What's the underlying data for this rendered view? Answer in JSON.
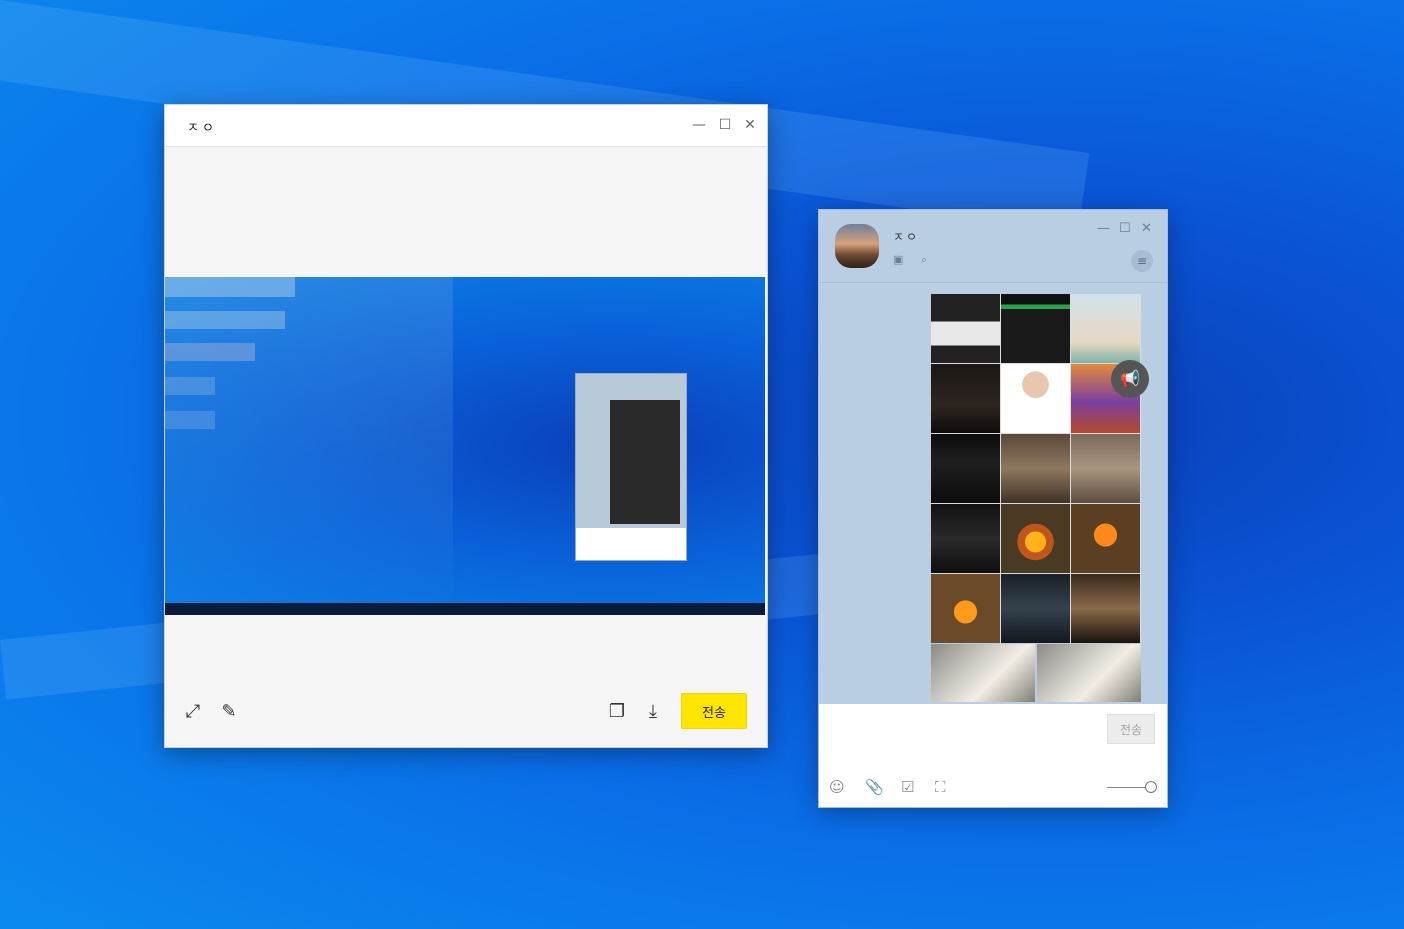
{
  "preview_window": {
    "title": "ㅈㅇ",
    "controls": {
      "minimize": "—",
      "maximize": "☐",
      "close": "✕"
    },
    "toolbar": {
      "expand_icon": "⤢",
      "edit_icon": "✎",
      "copy_icon": "❐",
      "download_icon": "⤓",
      "send_label": "전송"
    }
  },
  "chat_window": {
    "name": "ㅈㅇ",
    "header_icons": {
      "drawer": "▣",
      "search": "⌕",
      "menu": "≡"
    },
    "controls": {
      "minimize": "—",
      "maximize": "☐",
      "close": "✕"
    },
    "notice_icon": "📢",
    "send_label": "전송",
    "bottom_icons": {
      "emoji": "☺",
      "attach": "📎",
      "calendar": "☑",
      "capture": "⛶"
    }
  },
  "colors": {
    "send_button": "#fee500",
    "chat_background": "#b9cee3"
  }
}
